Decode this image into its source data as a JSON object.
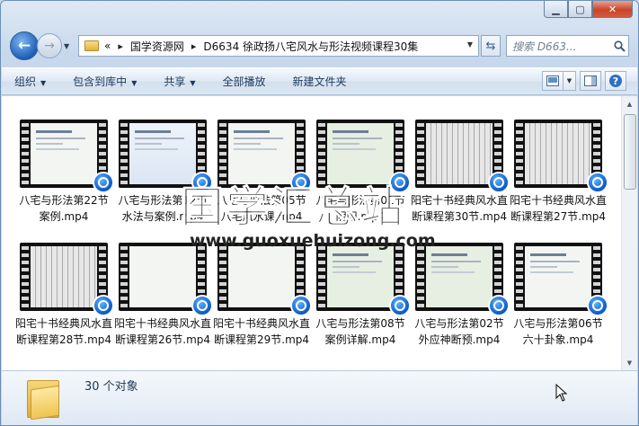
{
  "address": {
    "overflow_chevron": "«",
    "crumbs": [
      "国学资源网",
      "D6634 徐政扬八宅风水与形法视频课程30集"
    ],
    "separator": "▸"
  },
  "search": {
    "placeholder": "搜索 D663..."
  },
  "toolbar": {
    "organize": "组织",
    "include_library": "包含到库中",
    "share": "共享",
    "play_all": "全部播放",
    "new_folder": "新建文件夹"
  },
  "files": [
    {
      "name": "八宅与形法第22节案例.mp4",
      "style": "doc"
    },
    {
      "name": "八宅与形法第12节水法与案例.mp4",
      "style": "blue"
    },
    {
      "name": "八宅与形法第05节八宅风水课.mp4",
      "style": "doc"
    },
    {
      "name": "八宅与形法第01节阴阳.mp4",
      "style": "green"
    },
    {
      "name": "阳宅十书经典风水直断课程第30节.mp4",
      "style": "sheet"
    },
    {
      "name": "阳宅十书经典风水直断课程第27节.mp4",
      "style": "sheet"
    },
    {
      "name": "阳宅十书经典风水直断课程第28节.mp4",
      "style": "sheet"
    },
    {
      "name": "阳宅十书经典风水直断课程第26节.mp4",
      "style": "white"
    },
    {
      "name": "阳宅十书经典风水直断课程第29节.mp4",
      "style": "white"
    },
    {
      "name": "八宅与形法第08节案例详解.mp4",
      "style": "green"
    },
    {
      "name": "八宅与形法第02节外应神断预.mp4",
      "style": "green"
    },
    {
      "name": "八宅与形法第06节六十卦象.mp4",
      "style": "doc"
    }
  ],
  "watermark": {
    "text": "国学汇总站",
    "url": "www.guoxuehuizong.com"
  },
  "status": {
    "count": "30 个对象"
  },
  "colors": {
    "accent": "#1d5fb8",
    "toolbar_text": "#1e395b",
    "badge": "#0b58c9"
  }
}
